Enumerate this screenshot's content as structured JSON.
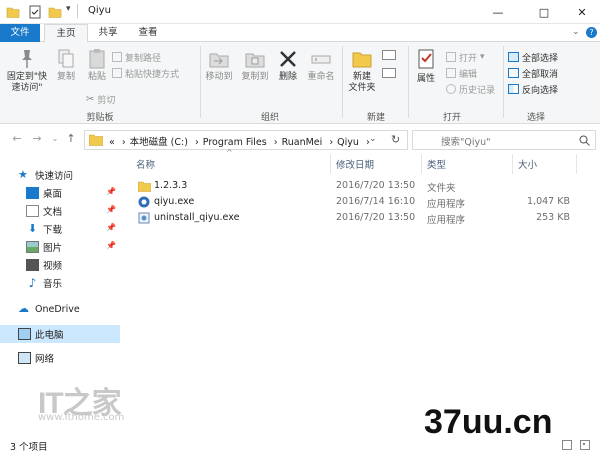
{
  "window": {
    "title": "Qiyu",
    "min": "—",
    "max": "□",
    "close": "✕",
    "help": "?"
  },
  "ribbon_tabs": [
    "文件",
    "主页",
    "共享",
    "查看"
  ],
  "ribbon": {
    "clipboard": {
      "pin": "固定到\"快\n速访问\"",
      "copy": "复制",
      "paste": "粘贴",
      "copy_path": "复制路径",
      "paste_shortcut": "粘贴快捷方式",
      "cut": "剪切",
      "label": "剪贴板"
    },
    "organize": {
      "move_to": "移动到",
      "copy_to": "复制到",
      "delete": "删除",
      "rename": "重命名",
      "label": "组织"
    },
    "new": {
      "new_folder": "新建\n文件夹",
      "label": "新建"
    },
    "open": {
      "properties": "属性",
      "open": "打开",
      "edit": "编辑",
      "history": "历史记录",
      "label": "打开"
    },
    "select": {
      "select_all": "全部选择",
      "select_none": "全部取消",
      "invert": "反向选择",
      "label": "选择"
    }
  },
  "address": {
    "prefix": "«",
    "path": [
      "本地磁盘 (C:)",
      "Program Files",
      "RuanMei",
      "Qiyu"
    ],
    "search_placeholder": "搜索\"Qiyu\""
  },
  "nav": {
    "quick_access": "快速访问",
    "items": [
      {
        "label": "桌面",
        "pinned": true
      },
      {
        "label": "文档",
        "pinned": true
      },
      {
        "label": "下载",
        "pinned": true
      },
      {
        "label": "图片",
        "pinned": true
      },
      {
        "label": "视频",
        "pinned": false
      },
      {
        "label": "音乐",
        "pinned": false
      }
    ],
    "onedrive": "OneDrive",
    "this_pc": "此电脑",
    "network": "网络"
  },
  "columns": {
    "name": "名称",
    "date": "修改日期",
    "type": "类型",
    "size": "大小"
  },
  "files": [
    {
      "name": "1.2.3.3",
      "date": "2016/7/20 13:50",
      "type": "文件夹",
      "size": ""
    },
    {
      "name": "qiyu.exe",
      "date": "2016/7/14 16:10",
      "type": "应用程序",
      "size": "1,047 KB"
    },
    {
      "name": "uninstall_qiyu.exe",
      "date": "2016/7/20 13:50",
      "type": "应用程序",
      "size": "253 KB"
    }
  ],
  "status": {
    "count": "3 个项目"
  },
  "watermarks": {
    "ithome_logo": "IT之家",
    "ithome_url": "www.ithome.com",
    "site": "37uu.cn"
  },
  "colors": {
    "accent": "#1979ca",
    "selected": "#cce8ff",
    "folder": "#f3c94c"
  }
}
